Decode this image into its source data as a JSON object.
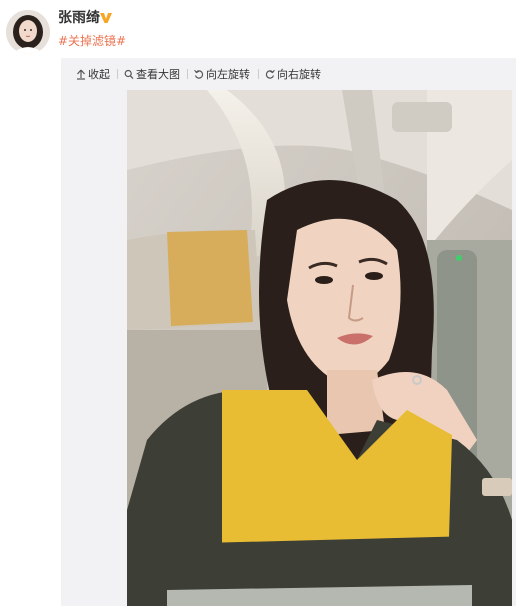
{
  "post": {
    "username": "张雨绮",
    "topic": "#关掉滤镜#"
  },
  "toolbar": {
    "collapse_label": "收起",
    "view_large_label": "查看大图",
    "rotate_left_label": "向左旋转",
    "rotate_right_label": "向右旋转"
  },
  "colors": {
    "topic_link": "#eb7350",
    "verified_badge": "#f6a623",
    "panel_bg": "#f2f2f5"
  }
}
